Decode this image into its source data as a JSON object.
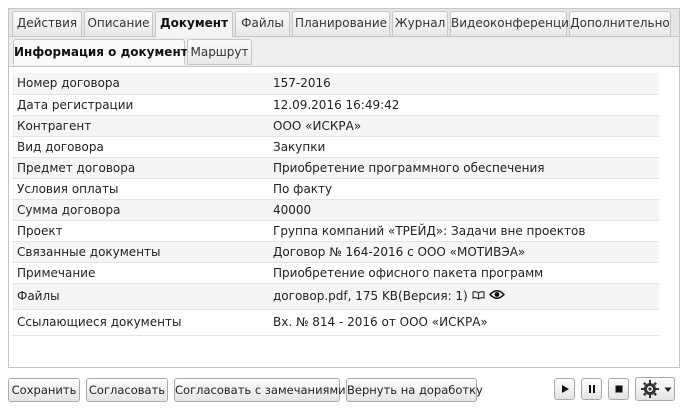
{
  "tabs": [
    {
      "label": "Действия"
    },
    {
      "label": "Описание"
    },
    {
      "label": "Документ"
    },
    {
      "label": "Файлы"
    },
    {
      "label": "Планирование"
    },
    {
      "label": "Журнал"
    },
    {
      "label": "Видеоконференции"
    },
    {
      "label": "Дополнительно"
    }
  ],
  "subtabs": [
    {
      "label": "Информация о документе"
    },
    {
      "label": "Маршрут"
    }
  ],
  "fields": [
    {
      "label": "Номер договора",
      "value": "157-2016"
    },
    {
      "label": "Дата регистрации",
      "value": "12.09.2016 16:49:42"
    },
    {
      "label": "Контрагент",
      "value": "ООО «ИСКРА»"
    },
    {
      "label": "Вид договора",
      "value": "Закупки"
    },
    {
      "label": "Предмет договора",
      "value": "Приобретение программного обеспечения"
    },
    {
      "label": "Условия оплаты",
      "value": "По факту"
    },
    {
      "label": "Сумма договора",
      "value": "40000"
    },
    {
      "label": "Проект",
      "value": "Группа компаний «ТРЕЙД»: Задачи вне проектов"
    },
    {
      "label": "Связанные документы",
      "value": "Договор № 164-2016 с ООО «МОТИВЭА»"
    },
    {
      "label": "Примечание",
      "value": "Приобретение офисного пакета программ"
    },
    {
      "label": "Файлы",
      "value": "договор.pdf, 175 KB(Версия: 1)"
    },
    {
      "label": "Ссылающиеся документы",
      "value": "Вх. № 814 - 2016 от ООО «ИСКРА»"
    }
  ],
  "buttons": {
    "save": "Сохранить",
    "approve": "Согласовать",
    "approve_remarks": "Согласовать с замечаниями",
    "return": "Вернуть на доработку"
  },
  "icons": {
    "files_view": "eye-icon",
    "files_read": "book-icon",
    "play": "play-icon",
    "pause": "pause-icon",
    "stop": "stop-icon",
    "settings": "gear-icon",
    "dropdown": "chevron-down-icon"
  }
}
